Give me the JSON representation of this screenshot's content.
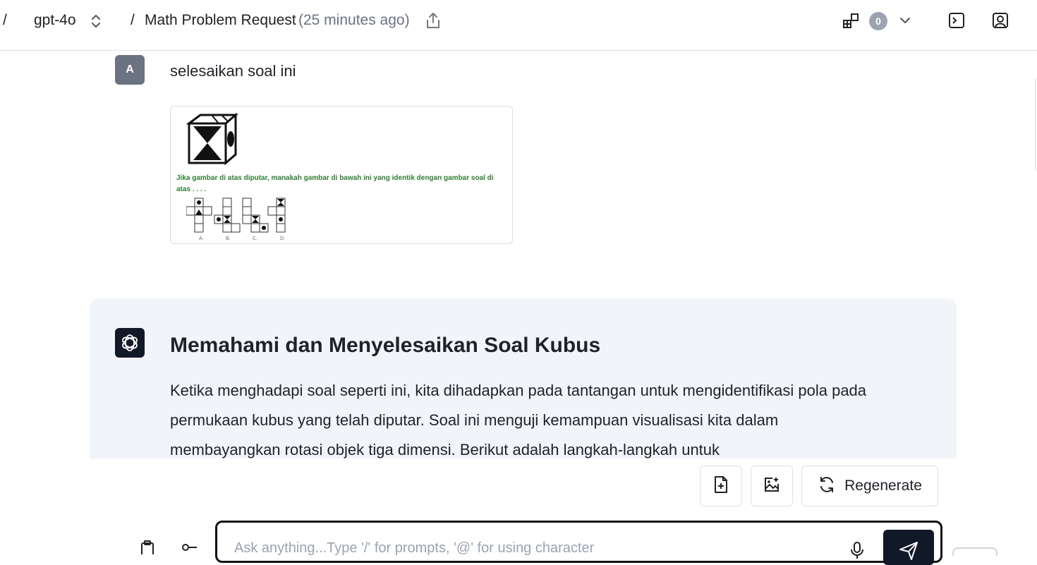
{
  "header": {
    "root_slash": "/",
    "model_name": "gpt-4o",
    "separator": "/",
    "chat_title": "Math Problem Request",
    "chat_time": "(25 minutes ago)",
    "badge_count": "0"
  },
  "user_message": {
    "avatar_initial": "A",
    "text": "selesaikan soal ini",
    "attachment": {
      "question": "Jika gambar di atas diputar, manakah gambar di bawah ini yang identik dengan gambar soal di atas . . . .",
      "option_labels": [
        "A.",
        "B.",
        "C.",
        "D."
      ]
    }
  },
  "assistant_message": {
    "title": "Memahami dan Menyelesaikan Soal Kubus",
    "body": "Ketika menghadapi soal seperti ini, kita dihadapkan pada tantangan untuk mengidentifikasi pola pada permukaan kubus yang telah diputar. Soal ini menguji kemampuan visualisasi kita dalam membayangkan rotasi objek tiga dimensi. Berikut adalah langkah-langkah untuk"
  },
  "actions": {
    "regenerate_label": "Regenerate"
  },
  "input": {
    "placeholder": "Ask anything...Type '/' for prompts, '@' for using character"
  },
  "colors": {
    "card_bg": "#f1f4f8",
    "input_border": "#111111",
    "send_bg": "#111827",
    "badge_bg": "#9ca3af",
    "question_text": "#2f7d32"
  },
  "icons": [
    "chevron-updown-icon",
    "share-icon",
    "apps-icon",
    "chevron-down-icon",
    "terminal-icon",
    "profile-icon",
    "openai-logo-icon",
    "file-add-icon",
    "image-add-icon",
    "refresh-icon",
    "clipboard-icon",
    "key-icon",
    "mic-icon",
    "send-icon"
  ]
}
